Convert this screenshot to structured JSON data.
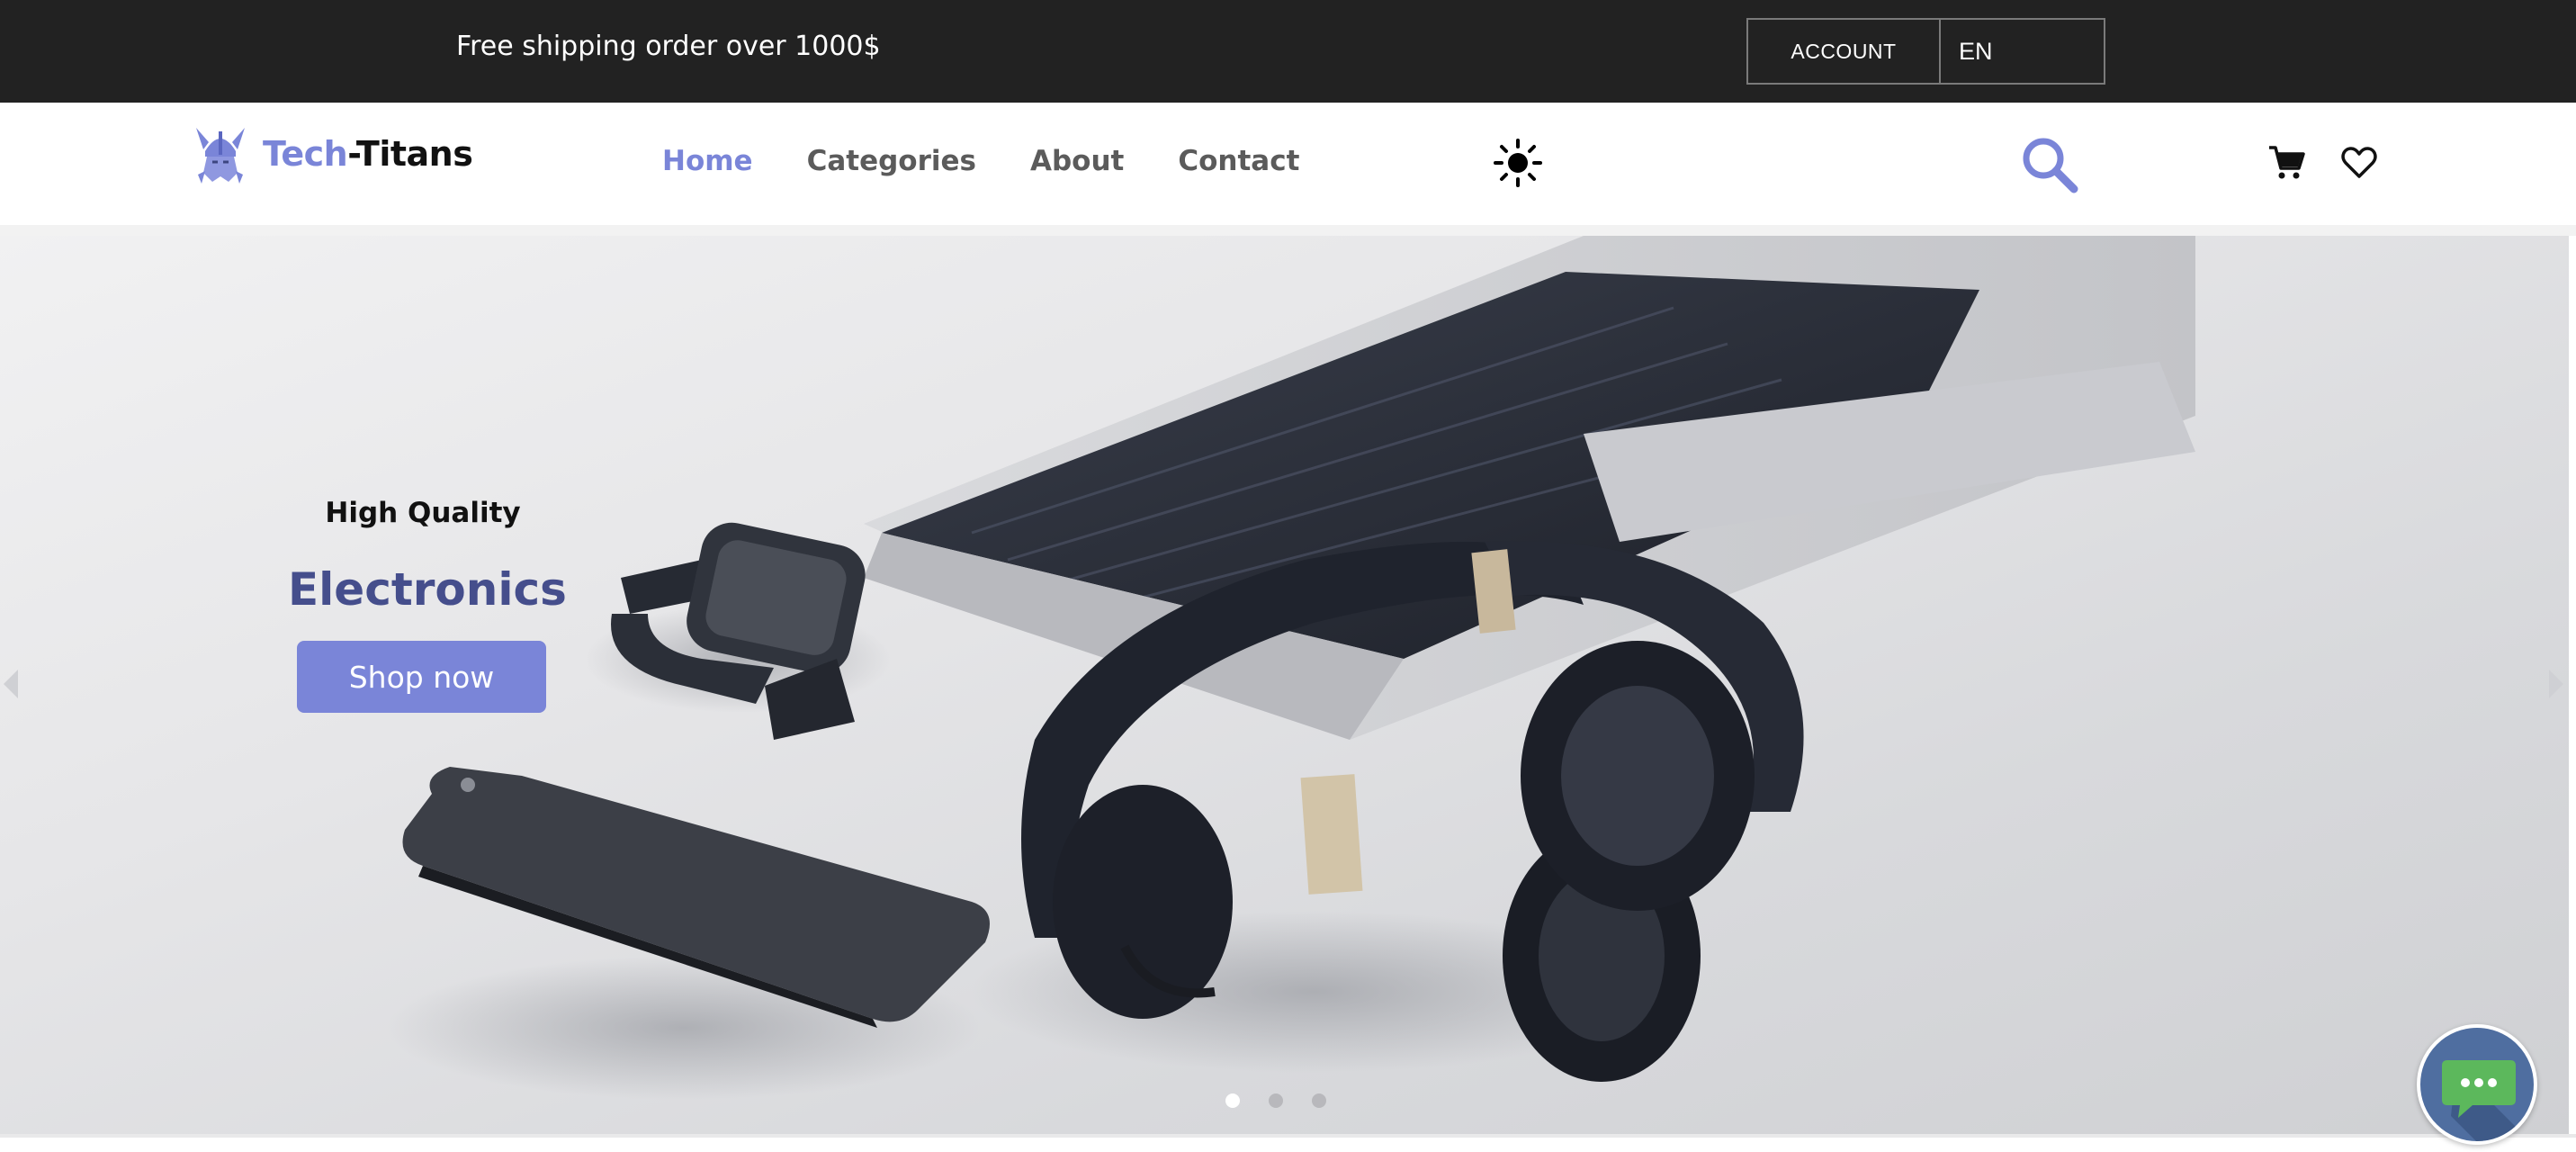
{
  "topbar": {
    "shipping_text": "Free shipping order over 1000$",
    "account_label": "ACCOUNT",
    "language_label": "EN"
  },
  "logo": {
    "text_part1": "Tech",
    "text_part2": "-Titans",
    "icon": "viking-helmet-icon"
  },
  "nav": {
    "links": [
      {
        "label": "Home",
        "active": true
      },
      {
        "label": "Categories",
        "active": false
      },
      {
        "label": "About",
        "active": false
      },
      {
        "label": "Contact",
        "active": false
      }
    ],
    "icons": [
      "sun-icon",
      "search-icon",
      "cart-icon",
      "heart-icon"
    ]
  },
  "hero": {
    "subtitle": "High Quality",
    "title": "Electronics",
    "cta_label": "Shop now",
    "slide_count": 3,
    "active_slide": 1
  },
  "chat": {
    "icon": "chat-bubble-icon"
  },
  "colors": {
    "accent": "#7a85d8",
    "title_dark_blue": "#454e8c",
    "topbar_bg": "#222222",
    "chat_bg": "#4f6ea0",
    "chat_bubble": "#5cb85c"
  }
}
